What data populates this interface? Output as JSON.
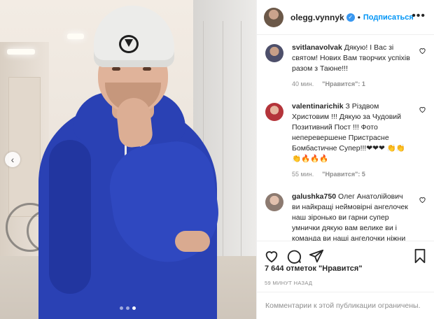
{
  "post": {
    "author": "olegg.vynnyk",
    "verified": true,
    "separator": "•",
    "follow_label": "Подписаться",
    "more_icon": "more-horizontal-icon",
    "carousel": {
      "slides": 3,
      "active_index": 2
    }
  },
  "comments": [
    {
      "username": "svitlanavolvak",
      "text": "Дякую! І Вас зі святом! Нових Вам творчих успіхів разом з Таюне!!!",
      "time": "40 мин.",
      "likes": "\"Нравится\": 1"
    },
    {
      "username": "valentinarichik",
      "text": "З Різдвом Христовим !!! Дякую за Чудовий Позитивний Пост !!! Фото неперевершене Пристрасне Бомбастичне Супер!!!❤❤❤ 👏👏👏🔥🔥🔥",
      "time": "55 мин.",
      "likes": "\"Нравится\": 5"
    },
    {
      "username": "galushka750",
      "text": "Олег Анатолійович ви найкращі неймовірні ангелочек наш зіронько ви гарни супер умнички дякую вам велике ви і команда ви наші ангелочки ніжни добри светли",
      "time": "",
      "likes": ""
    }
  ],
  "actions": {
    "like_icon": "heart-icon",
    "comment_icon": "comment-icon",
    "share_icon": "share-icon",
    "save_icon": "bookmark-icon"
  },
  "stats": {
    "likes_text": "7 644 отметок \"Нравится\"",
    "posted_ago": "59 минут назад"
  },
  "comments_closed_text": "Комментарии к этой публикации ограничены.",
  "colors": {
    "accent": "#0095f6",
    "hoodie": "#2a41b4",
    "muted": "#8e8e8e"
  }
}
